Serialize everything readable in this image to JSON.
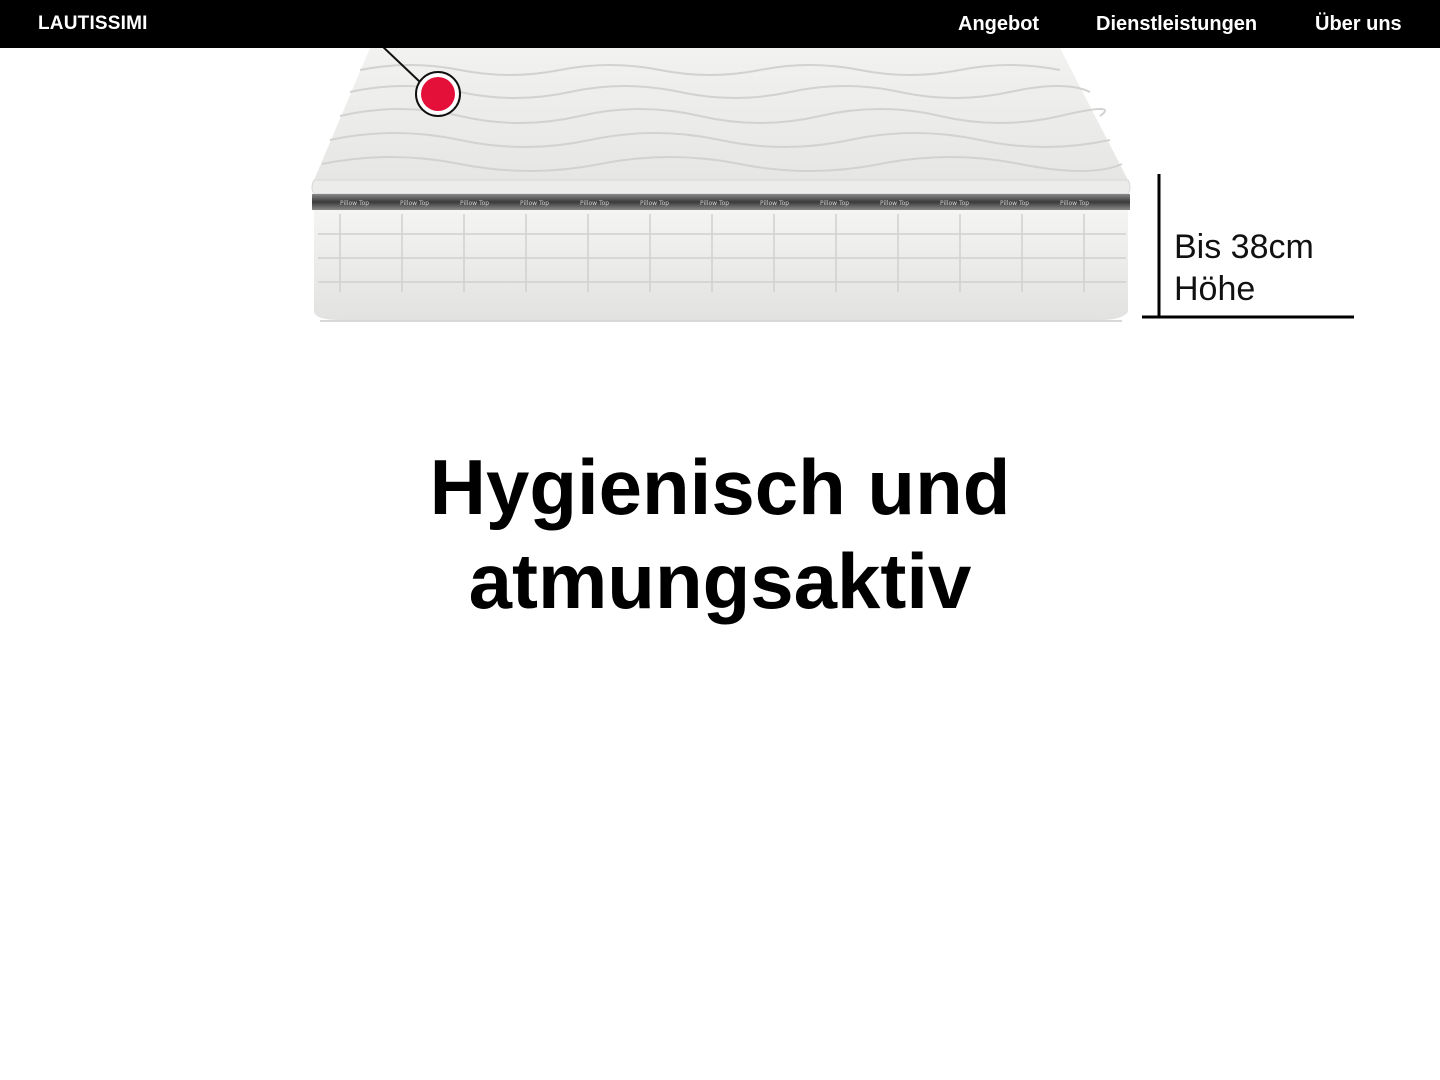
{
  "brand": {
    "name": "LAUTISSIMI"
  },
  "nav": {
    "items": [
      {
        "label": "Angebot"
      },
      {
        "label": "Dienstleistungen"
      },
      {
        "label": "Über uns"
      }
    ]
  },
  "product": {
    "height_line1": "Bis 38cm",
    "height_line2": "Höhe",
    "hotspot_color": "#e4103a",
    "band_text": "Pillow Top by Klama"
  },
  "hero": {
    "headline_line1": "Hygienisch und",
    "headline_line2": "atmungsaktiv"
  },
  "colors": {
    "nav_background": "#000000",
    "nav_text": "#ffffff",
    "accent": "#e4103a",
    "page_background": "#ffffff"
  }
}
